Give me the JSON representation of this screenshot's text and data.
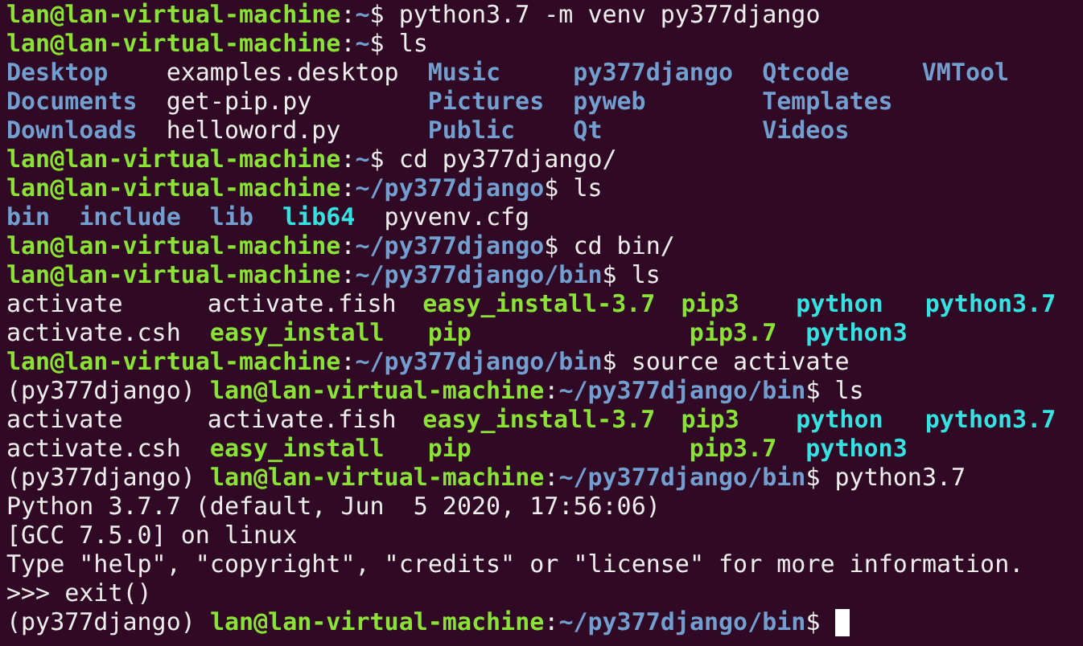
{
  "terminal": {
    "lines": [
      {
        "kind": "prompt",
        "user_host": "lan@lan-virtual-machine",
        "separator": ":",
        "path": "~",
        "symbol": "$",
        "command": "python3.7 -m venv py377django"
      },
      {
        "kind": "prompt",
        "user_host": "lan@lan-virtual-machine",
        "separator": ":",
        "path": "~",
        "symbol": "$",
        "command": "ls"
      },
      {
        "kind": "listing",
        "items": [
          {
            "name": "Desktop",
            "kind": "dir"
          },
          {
            "name": "examples.desktop",
            "kind": "file"
          },
          {
            "name": "Music",
            "kind": "dir"
          },
          {
            "name": "py377django",
            "kind": "dir"
          },
          {
            "name": "Qtcode",
            "kind": "dir"
          },
          {
            "name": "VMTool",
            "kind": "dir"
          }
        ]
      },
      {
        "kind": "listing",
        "items": [
          {
            "name": "Documents",
            "kind": "dir"
          },
          {
            "name": "get-pip.py",
            "kind": "file"
          },
          {
            "name": "Pictures",
            "kind": "dir"
          },
          {
            "name": "pyweb",
            "kind": "dir"
          },
          {
            "name": "Templates",
            "kind": "dir"
          }
        ]
      },
      {
        "kind": "listing",
        "items": [
          {
            "name": "Downloads",
            "kind": "dir"
          },
          {
            "name": "helloword.py",
            "kind": "file"
          },
          {
            "name": "Public",
            "kind": "dir"
          },
          {
            "name": "Qt",
            "kind": "dir"
          },
          {
            "name": "Videos",
            "kind": "dir"
          }
        ]
      },
      {
        "kind": "prompt",
        "user_host": "lan@lan-virtual-machine",
        "separator": ":",
        "path": "~",
        "symbol": "$",
        "command": "cd py377django/"
      },
      {
        "kind": "prompt",
        "user_host": "lan@lan-virtual-machine",
        "separator": ":",
        "path": "~/py377django",
        "symbol": "$",
        "command": "ls"
      },
      {
        "kind": "listing",
        "items": [
          {
            "name": "bin",
            "kind": "dir"
          },
          {
            "name": "include",
            "kind": "dir"
          },
          {
            "name": "lib",
            "kind": "dir"
          },
          {
            "name": "lib64",
            "kind": "link"
          },
          {
            "name": "pyvenv.cfg",
            "kind": "file"
          }
        ]
      },
      {
        "kind": "prompt",
        "user_host": "lan@lan-virtual-machine",
        "separator": ":",
        "path": "~/py377django",
        "symbol": "$",
        "command": "cd bin/"
      },
      {
        "kind": "prompt",
        "user_host": "lan@lan-virtual-machine",
        "separator": ":",
        "path": "~/py377django/bin",
        "symbol": "$",
        "command": "ls"
      },
      {
        "kind": "listing",
        "items": [
          {
            "name": "activate",
            "kind": "file"
          },
          {
            "name": "activate.fish",
            "kind": "file"
          },
          {
            "name": "easy_install-3.7",
            "kind": "exec"
          },
          {
            "name": "pip3",
            "kind": "exec"
          },
          {
            "name": "python",
            "kind": "link"
          },
          {
            "name": "python3.7",
            "kind": "link"
          }
        ]
      },
      {
        "kind": "listing",
        "items": [
          {
            "name": "activate.csh",
            "kind": "file"
          },
          {
            "name": "easy_install",
            "kind": "exec"
          },
          {
            "name": "pip",
            "kind": "exec"
          },
          {
            "name": "pip3.7",
            "kind": "exec"
          },
          {
            "name": "python3",
            "kind": "link"
          }
        ]
      },
      {
        "kind": "prompt",
        "user_host": "lan@lan-virtual-machine",
        "separator": ":",
        "path": "~/py377django/bin",
        "symbol": "$",
        "command": "source activate"
      },
      {
        "kind": "prompt",
        "env": "(py377django)",
        "user_host": "lan@lan-virtual-machine",
        "separator": ":",
        "path": "~/py377django/bin",
        "symbol": "$",
        "command": "ls"
      },
      {
        "kind": "listing",
        "items": [
          {
            "name": "activate",
            "kind": "file"
          },
          {
            "name": "activate.fish",
            "kind": "file"
          },
          {
            "name": "easy_install-3.7",
            "kind": "exec"
          },
          {
            "name": "pip3",
            "kind": "exec"
          },
          {
            "name": "python",
            "kind": "link"
          },
          {
            "name": "python3.7",
            "kind": "link"
          }
        ]
      },
      {
        "kind": "listing",
        "items": [
          {
            "name": "activate.csh",
            "kind": "file"
          },
          {
            "name": "easy_install",
            "kind": "exec"
          },
          {
            "name": "pip",
            "kind": "exec"
          },
          {
            "name": "pip3.7",
            "kind": "exec"
          },
          {
            "name": "python3",
            "kind": "link"
          }
        ]
      },
      {
        "kind": "prompt",
        "env": "(py377django)",
        "user_host": "lan@lan-virtual-machine",
        "separator": ":",
        "path": "~/py377django/bin",
        "symbol": "$",
        "command": "python3.7"
      },
      {
        "kind": "output",
        "text": "Python 3.7.7 (default, Jun  5 2020, 17:56:06)"
      },
      {
        "kind": "output",
        "text": "[GCC 7.5.0] on linux"
      },
      {
        "kind": "output",
        "text": "Type \"help\", \"copyright\", \"credits\" or \"license\" for more information."
      },
      {
        "kind": "output",
        "text": ">>> exit()"
      },
      {
        "kind": "prompt",
        "env": "(py377django)",
        "user_host": "lan@lan-virtual-machine",
        "separator": ":",
        "path": "~/py377django/bin",
        "symbol": "$",
        "cursor": true
      }
    ]
  }
}
